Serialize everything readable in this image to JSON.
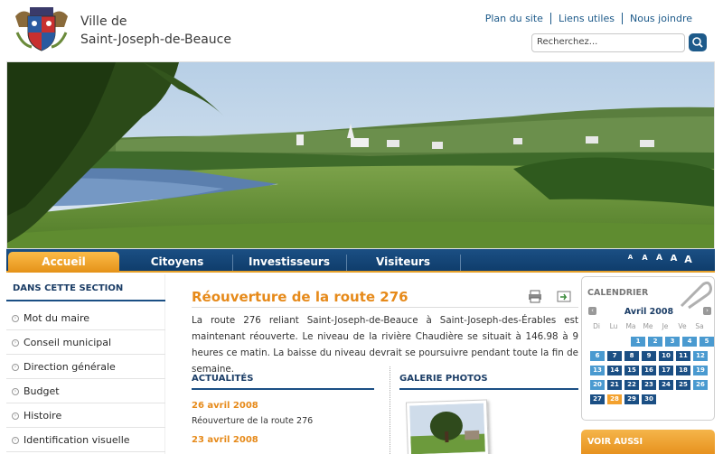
{
  "header": {
    "city_line1": "Ville de",
    "city_line2": "Saint-Joseph-de-Beauce",
    "links": [
      "Plan du site",
      "Liens utiles",
      "Nous joindre"
    ],
    "search_placeholder": "Recherchez..."
  },
  "nav": {
    "tabs": [
      "Accueil",
      "Citoyens",
      "Investisseurs",
      "Visiteurs"
    ],
    "active_tab": "Accueil",
    "font_sizes": [
      "A",
      "A",
      "A",
      "A",
      "A"
    ]
  },
  "sidebar": {
    "heading": "DANS CETTE SECTION",
    "items": [
      "Mot du maire",
      "Conseil municipal",
      "Direction générale",
      "Budget",
      "Histoire",
      "Identification visuelle"
    ]
  },
  "main": {
    "title": "Réouverture de la route 276",
    "body": "La route 276 reliant Saint-Joseph-de-Beauce à Saint-Joseph-des-Érables est maintenant réouverte. Le niveau de la rivière Chaudière se situait à 146.98 à 9 heures ce matin. La baisse du niveau devrait se poursuivre pendant toute la fin de semaine.",
    "news_heading": "ACTUALITÉS",
    "news": [
      {
        "date": "26 avril 2008",
        "title": "Réouverture de la route 276"
      },
      {
        "date": "23 avril 2008",
        "title": ""
      }
    ],
    "gallery_heading": "GALERIE PHOTOS"
  },
  "calendar": {
    "heading": "CALENDRIER",
    "month": "Avril 2008",
    "weekdays": [
      "Di",
      "Lu",
      "Ma",
      "Me",
      "Je",
      "Ve",
      "Sa"
    ],
    "days": [
      "1",
      "2",
      "3",
      "4",
      "5",
      "6",
      "7",
      "8",
      "9",
      "10",
      "11",
      "12",
      "13",
      "14",
      "15",
      "16",
      "17",
      "18",
      "19",
      "20",
      "21",
      "22",
      "23",
      "24",
      "25",
      "26",
      "27",
      "28",
      "29",
      "30"
    ],
    "today": "28"
  },
  "see_also": {
    "heading": "VOIR AUSSI"
  },
  "colors": {
    "primary": "#1b4f84",
    "accent": "#e68a1a",
    "tab_active": "#f3a12e"
  }
}
